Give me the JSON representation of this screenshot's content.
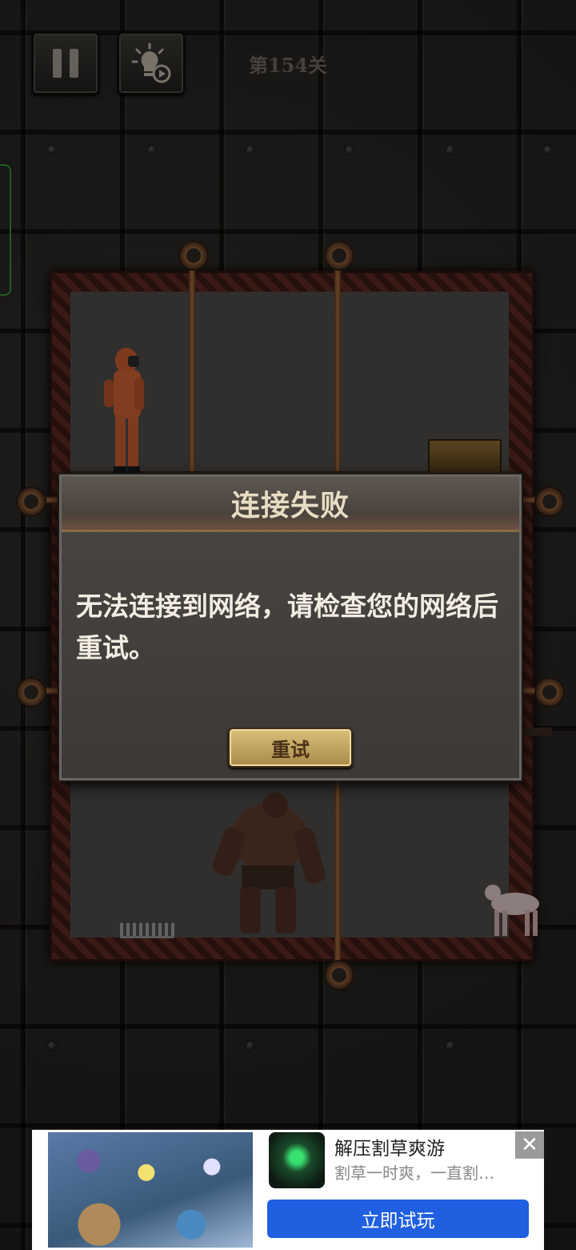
{
  "hud": {
    "level": "第154关",
    "pause_icon": "pause-icon",
    "hint_icon": "lightbulb-video-icon"
  },
  "dialog": {
    "title": "连接失败",
    "message": "无法连接到网络，请检查您的网络后重试。",
    "retry_label": "重试"
  },
  "ad": {
    "title": "解压割草爽游",
    "description": "割草一时爽，一直割…",
    "cta_label": "立即试玩",
    "close_symbol": "✕"
  },
  "colors": {
    "cta_blue": "#1f5fe0",
    "dialog_title": "#e8dcc4",
    "retry_gold": "#d8bf7a"
  }
}
